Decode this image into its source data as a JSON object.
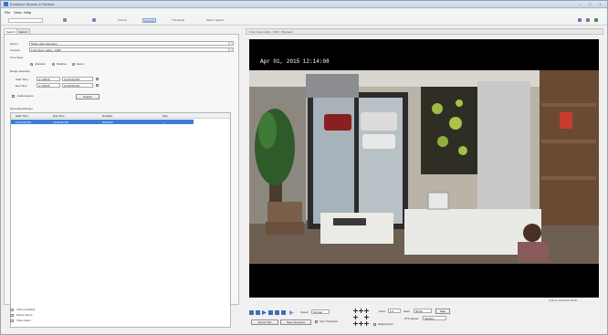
{
  "window": {
    "title": "Evidence Search & Review"
  },
  "menu": [
    "File",
    "View",
    "Help"
  ],
  "toolbar": {
    "buttons": [
      "Archive",
      "Timeline",
      "Thumbnail",
      "Motion Search"
    ]
  },
  "tabs": [
    "Search",
    "Export"
  ],
  "search": {
    "server_label": "Server",
    "server_value": "NVR-Lobby-Recorder",
    "camera_label": "Camera",
    "camera_value": "Front Door Lobby - 1080",
    "time_label": "Time Span",
    "radio_options": [
      "Absolute",
      "Relative",
      "Event"
    ],
    "range_label": "Range Selection",
    "start_label": "Start Time",
    "start_date": "4/ 1/2015",
    "start_time": "12:00:00 PM",
    "end_label": "End Time",
    "end_date": "4/ 1/2015",
    "end_time": "12:59:59 PM",
    "include_label": "Audio Events",
    "search_button": "Search"
  },
  "results": {
    "section_label": "Recording Ranges",
    "columns": [
      "Start Time",
      "End Time",
      "Duration",
      "Size"
    ],
    "rows": [
      {
        "start": "12:00:00 PM",
        "end": "12:59:59 PM",
        "duration": "00:59:59",
        "size": "—"
      }
    ]
  },
  "legend": [
    {
      "label": "Video Available",
      "color": "#e8e8e8"
    },
    {
      "label": "Motion Event",
      "color": "#dfe9f5"
    },
    {
      "label": "Video Alarm",
      "color": "#e9e9e9"
    }
  ],
  "video": {
    "header": "Front Door Lobby - 1080  ·  Playback",
    "timestamp": "Apr 01, 2015 12:14:08",
    "status": "Archive Playback Mode"
  },
  "controls": {
    "speed_label": "Speed",
    "speed_value": "Normal",
    "zoom_label": "Zoom",
    "zoom_value": "1.0",
    "seek_label": "Seek",
    "seek_value": "00:00",
    "step_label": "Step",
    "mode_label": "PTZ Speed",
    "mode_value": "Medium",
    "export_button": "Export Clip",
    "snapshot_button": "Save Snapshot",
    "sync_label": "Sync Playback",
    "digital_zoom_label": "Digital Zoom"
  },
  "colors": {
    "accent": "#3b7fd4",
    "panel": "#f7f7f7"
  }
}
